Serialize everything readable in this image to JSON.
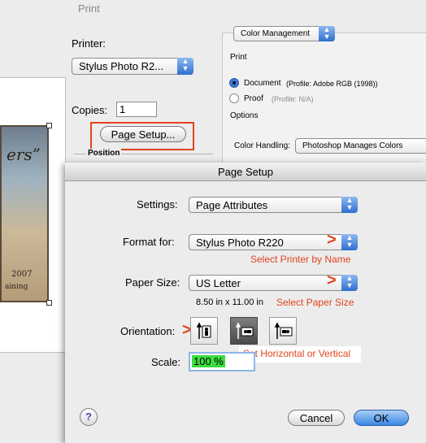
{
  "print_window": {
    "title": "Print",
    "printer_label": "Printer:",
    "printer_value": "Stylus Photo R2...",
    "copies_label": "Copies:",
    "copies_value": "1",
    "page_setup_button": "Page Setup...",
    "position_label": "Position"
  },
  "preview": {
    "photo_text_top": "ers”",
    "photo_text_year": "2007",
    "photo_text_bottom": "aining"
  },
  "color_management": {
    "popup_value": "Color Management",
    "print_label": "Print",
    "document_label": "Document",
    "document_profile": "(Profile: Adobe RGB (1998))",
    "proof_label": "Proof",
    "proof_profile": "(Profile: N/A)",
    "options_label": "Options",
    "color_handling_label": "Color Handling:",
    "color_handling_value": "Photoshop Manages Colors"
  },
  "page_setup": {
    "title": "Page Setup",
    "settings_label": "Settings:",
    "settings_value": "Page Attributes",
    "format_label": "Format for:",
    "format_value": "Stylus Photo R220",
    "paper_label": "Paper Size:",
    "paper_value": "US Letter",
    "paper_dims": "8.50 in x 11.00 in",
    "orientation_label": "Orientation:",
    "scale_label": "Scale:",
    "scale_value": "100 %",
    "cancel_button": "Cancel",
    "ok_button": "OK",
    "help_button": "?"
  },
  "annotations": {
    "select_printer": "Select Printer by Name",
    "select_paper": "Select Paper Size",
    "set_orientation": "Set Horizontal or Vertical",
    "color": "#e0441e"
  }
}
